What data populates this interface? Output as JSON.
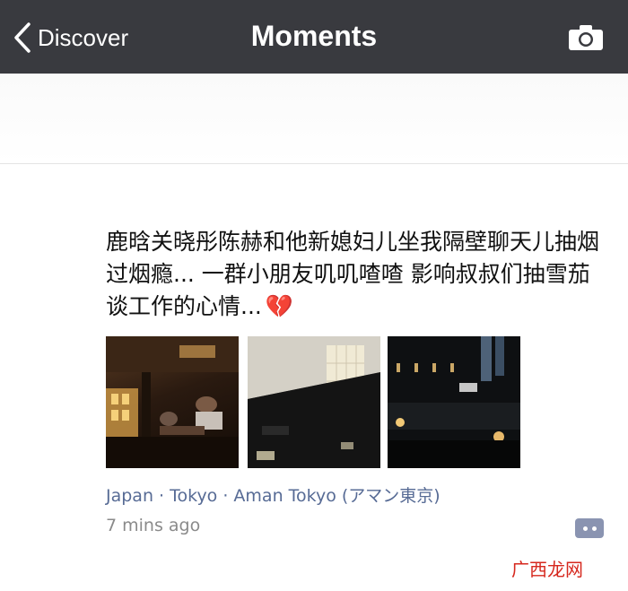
{
  "nav": {
    "back_label": "Discover",
    "title": "Moments"
  },
  "post": {
    "text": "鹿晗关晓彤陈赫和他新媳妇儿坐我隔壁聊天儿抽烟过烟瘾... 一群小朋友叽叽喳喳 影响叔叔们抽雪茄谈工作的心情...",
    "emoji": "💔",
    "location": "Japan · Tokyo · Aman Tokyo (アマン東京)",
    "time": "7 mins ago",
    "photos": [
      "photo-1",
      "photo-2",
      "photo-3"
    ]
  },
  "watermark": {
    "text": "广西龙网"
  },
  "colors": {
    "navbar": "#393a3f",
    "link": "#576b95",
    "comment_button": "#8a94b1",
    "watermark": "#d6281e"
  },
  "icons": [
    "chevron-left-icon",
    "camera-icon",
    "comment-icon",
    "broken-heart-icon"
  ]
}
